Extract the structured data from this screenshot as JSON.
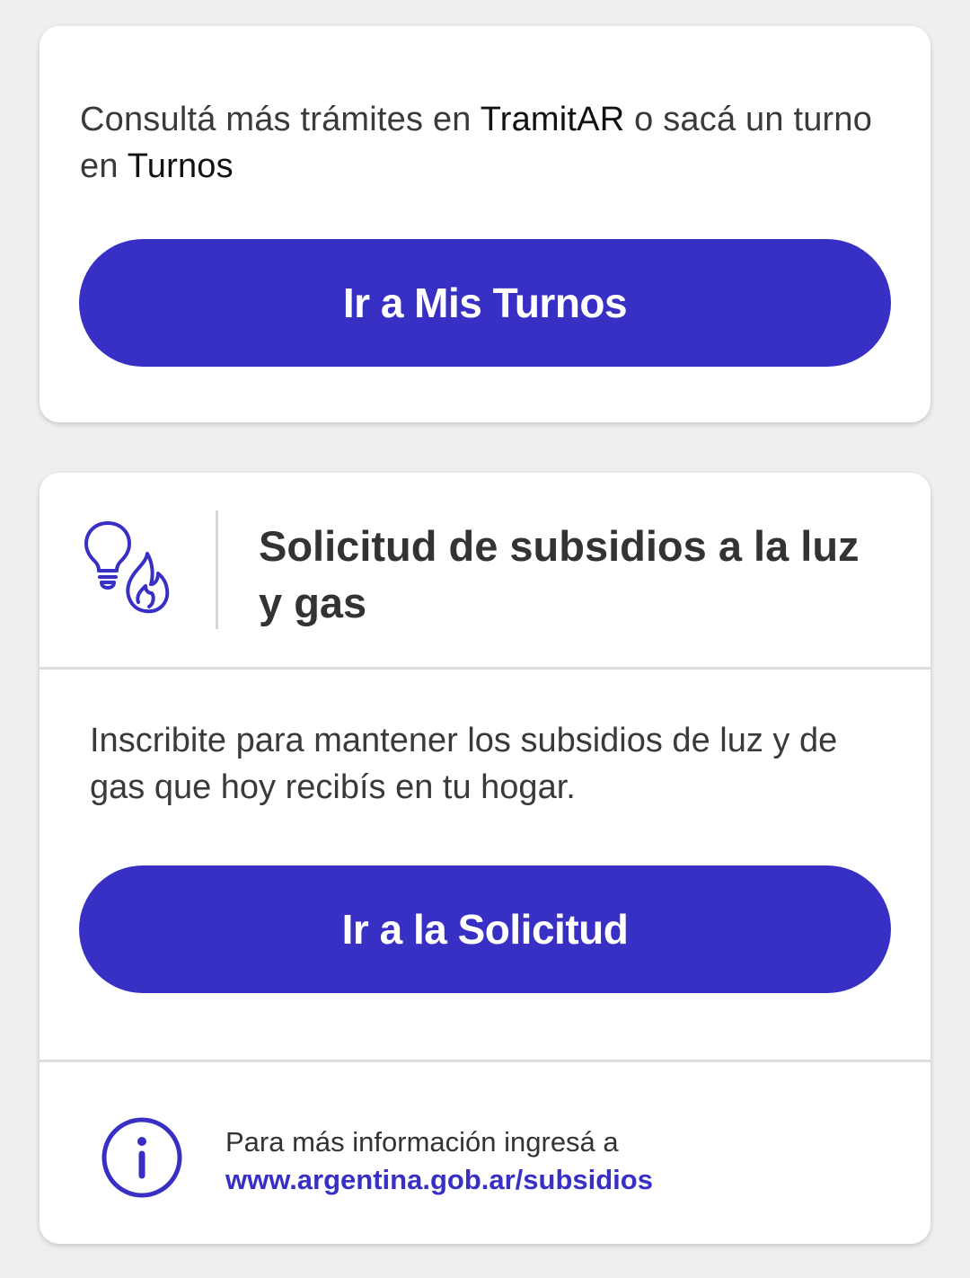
{
  "turnos_card": {
    "intro_part1": "Consultá más trámites en ",
    "intro_tramitar": "TramitAR",
    "intro_part2": " o sacá un turno en ",
    "intro_turnos": "Turnos",
    "button_label": "Ir a Mis Turnos"
  },
  "subsidio_card": {
    "icon": "lightbulb-flame-icon",
    "title": "Solicitud de subsidios a la luz y gas",
    "description": "Inscribite para mantener los subsidios de luz y de gas que hoy recibís en tu hogar.",
    "button_label": "Ir a la Solicitud",
    "info": {
      "icon": "info-icon",
      "text": "Para más información ingresá a",
      "link": "www.argentina.gob.ar/subsidios"
    }
  },
  "colors": {
    "accent": "#3830c4",
    "background": "#efefef",
    "card": "#ffffff",
    "text": "#3a3a3a"
  }
}
